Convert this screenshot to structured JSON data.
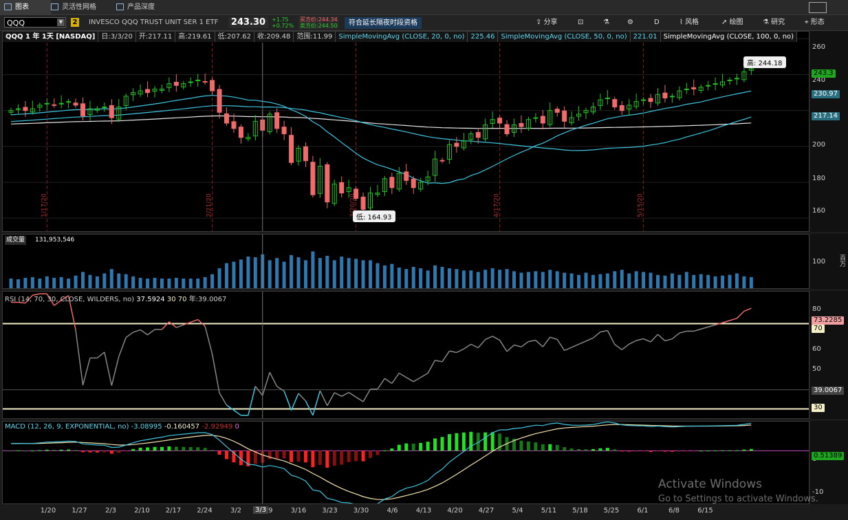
{
  "tabs": [
    {
      "label": "图表",
      "active": true
    },
    {
      "label": "灵活性网格",
      "active": false
    },
    {
      "label": "产品深度",
      "active": false
    }
  ],
  "toolbar": {
    "symbol": "QQQ",
    "link_badge": "2",
    "description": "INVESCO QQQ TRUST UNIT SER 1 ETF",
    "price": "243.30",
    "change": "+1.75",
    "change_pct": "+0.72%",
    "bid": "买方价:244.34",
    "ask": "卖方价:244.50",
    "extended_hours": "符合延长隔夜时段资格",
    "share": "分享",
    "period": "D",
    "style": "风格",
    "drawing": "绘图",
    "studies": "研究",
    "patterns": "形态"
  },
  "price_pane": {
    "info": [
      "QQQ 1 年 1天 [NASDAQ]",
      "日:3/3/20",
      "开:217.11",
      "高:219.61",
      "低:207.62",
      "收:209.48",
      "范围:11.99"
    ],
    "studies": [
      {
        "label": "SimpleMovingAvg (CLOSE, 20, 0, no)",
        "value": "225.46"
      },
      {
        "label": "SimpleMovingAvg (CLOSE, 50, 0, no)",
        "value": "221.01"
      },
      {
        "label": "SimpleMovingAvg (CLOSE, 100, 0, no)",
        "value": ""
      }
    ],
    "high_callout": "高: 244.18",
    "low_callout": "低: 164.93",
    "ticks": [
      "260",
      "240",
      "220",
      "200",
      "180",
      "160"
    ],
    "tags": [
      {
        "value": "243.3",
        "bg": "#1fa51f",
        "fg": "#000000"
      },
      {
        "value": "230.97",
        "bg": "#2a6f80",
        "fg": "#ffffff"
      },
      {
        "value": "217.14",
        "bg": "#2a6f80",
        "fg": "#ffffff"
      }
    ],
    "event_dates": [
      "1/17/20",
      "2/21/20",
      "3/20/20",
      "4/17/20",
      "5/15/20"
    ]
  },
  "volume_pane": {
    "label": "成交量",
    "value": "131,953,546",
    "ticks": [
      "100"
    ],
    "unit": "百万"
  },
  "rsi_pane": {
    "label": "RSI (14, 70, 30, CLOSE, WILDERS, no)",
    "value": "37.5924",
    "low": "30",
    "high": "70",
    "year": "年:39.0067",
    "ticks": [
      "80",
      "70",
      "60",
      "50",
      "40",
      "30"
    ],
    "tags": [
      {
        "value": "73.2285",
        "bg": "#f0a0a0",
        "fg": "#000000"
      },
      {
        "value": "70",
        "bg": "#f5f0c8",
        "fg": "#000000"
      },
      {
        "value": "39.0067",
        "bg": "#444444",
        "fg": "#ffffff"
      },
      {
        "value": "30",
        "bg": "#f5f0c8",
        "fg": "#000000"
      }
    ]
  },
  "macd_pane": {
    "label": "MACD (12, 26, 9, EXPONENTIAL, no)",
    "value": "-3.08995",
    "avg": "-0.160457",
    "diff": "-2.92949",
    "zero": "0",
    "ticks": [
      "0",
      "-10"
    ],
    "tag": {
      "value": "0.51389",
      "bg": "#1fa51f",
      "fg": "#000000"
    }
  },
  "x_axis": {
    "labels": [
      "1/20",
      "1/27",
      "2/3",
      "2/10",
      "2/17",
      "2/24",
      "3/2",
      "3/9",
      "3/16",
      "3/23",
      "3/30",
      "4/6",
      "4/13",
      "4/20",
      "4/27",
      "5/4",
      "5/11",
      "5/18",
      "5/25",
      "6/1",
      "6/8",
      "6/15"
    ],
    "cursor_label": "3/3"
  },
  "watermark": {
    "line1": "Activate Windows",
    "line2": "Go to Settings to activate Windows."
  },
  "chart_data": {
    "type": "candlestick",
    "dates": [
      "1/10",
      "1/13",
      "1/14",
      "1/15",
      "1/16",
      "1/17",
      "1/21",
      "1/22",
      "1/23",
      "1/24",
      "1/27",
      "1/28",
      "1/29",
      "1/30",
      "1/31",
      "2/3",
      "2/4",
      "2/5",
      "2/6",
      "2/7",
      "2/10",
      "2/11",
      "2/12",
      "2/13",
      "2/14",
      "2/18",
      "2/19",
      "2/20",
      "2/21",
      "2/24",
      "2/25",
      "2/26",
      "2/27",
      "2/28",
      "3/2",
      "3/3",
      "3/4",
      "3/5",
      "3/6",
      "3/9",
      "3/10",
      "3/11",
      "3/12",
      "3/13",
      "3/16",
      "3/17",
      "3/18",
      "3/19",
      "3/20",
      "3/23",
      "3/24",
      "3/25",
      "3/26",
      "3/27",
      "3/30",
      "3/31",
      "4/1",
      "4/2",
      "4/3",
      "4/6",
      "4/7",
      "4/8",
      "4/9",
      "4/13",
      "4/14",
      "4/15",
      "4/16",
      "4/17",
      "4/20",
      "4/21",
      "4/22",
      "4/23",
      "4/24",
      "4/27",
      "4/28",
      "4/29",
      "4/30",
      "5/1",
      "5/4",
      "5/5",
      "5/6",
      "5/7",
      "5/8",
      "5/11",
      "5/12",
      "5/13",
      "5/14",
      "5/15",
      "5/18",
      "5/19",
      "5/20",
      "5/21",
      "5/22",
      "5/26",
      "5/27",
      "5/28",
      "5/29",
      "6/1",
      "6/2",
      "6/3",
      "6/4",
      "6/5",
      "6/8",
      "6/9"
    ],
    "close": [
      220,
      221,
      220,
      221,
      223,
      224,
      223,
      224,
      225,
      223,
      217,
      221,
      221,
      222,
      216,
      222,
      228,
      230,
      231,
      230,
      232,
      232,
      235,
      234,
      235,
      236,
      237,
      236,
      231,
      219,
      213,
      210,
      205,
      205,
      214,
      209,
      218,
      210,
      207,
      191,
      199,
      192,
      173,
      189,
      169,
      179,
      174,
      177,
      171,
      164.9,
      174,
      174,
      182,
      177,
      185,
      181,
      177,
      180,
      183,
      193,
      192,
      201,
      200,
      203,
      207,
      205,
      212,
      215,
      213,
      207,
      212,
      211,
      215,
      216,
      213,
      220,
      219,
      214,
      216,
      218,
      220,
      222,
      226,
      227,
      222,
      220,
      223,
      225,
      226,
      225,
      229,
      227,
      228,
      231,
      232,
      232,
      233,
      234,
      235,
      236,
      237,
      238,
      241.6,
      243.3
    ],
    "ylim": [
      152,
      264
    ],
    "sma20_last": 230.97,
    "sma50_last": 221.01,
    "sma100_last": 217.14,
    "volume": [
      30,
      28,
      32,
      34,
      30,
      36,
      32,
      34,
      30,
      38,
      48,
      40,
      36,
      44,
      56,
      44,
      42,
      36,
      32,
      30,
      32,
      30,
      30,
      32,
      30,
      30,
      30,
      34,
      42,
      58,
      72,
      76,
      82,
      90,
      88,
      96,
      80,
      86,
      76,
      94,
      88,
      80,
      104,
      86,
      92,
      80,
      90,
      86,
      84,
      80,
      80,
      72,
      66,
      70,
      60,
      56,
      62,
      58,
      52,
      66,
      62,
      58,
      56,
      52,
      52,
      48,
      54,
      58,
      54,
      56,
      50,
      46,
      48,
      50,
      48,
      54,
      50,
      46,
      44,
      40,
      46,
      40,
      42,
      44,
      50,
      54,
      44,
      50,
      48,
      46,
      40,
      38,
      44,
      40,
      48,
      40,
      42,
      40,
      36,
      38,
      40,
      44,
      36,
      34
    ],
    "volume_ylim": [
      0,
      150
    ],
    "rsi_ylim": [
      25,
      85
    ],
    "macd_ylim": [
      -13,
      7
    ]
  }
}
